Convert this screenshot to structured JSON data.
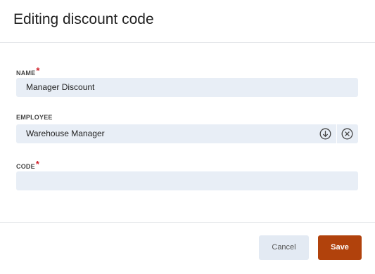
{
  "dialog": {
    "title": "Editing discount code"
  },
  "fields": {
    "name": {
      "label": "NAME",
      "required_mark": "*",
      "value": "Manager Discount",
      "placeholder": ""
    },
    "employee": {
      "label": "EMPLOYEE",
      "value": "Warehouse Manager",
      "icons": [
        "chevron-down-circle-icon",
        "clear-circle-icon"
      ]
    },
    "code": {
      "label": "CODE",
      "required_mark": "*",
      "value": "",
      "placeholder": ""
    }
  },
  "footer": {
    "cancel_label": "Cancel",
    "save_label": "Save"
  },
  "colors": {
    "accent": "#b1420c",
    "input_bg": "#e8eef6",
    "required": "#d0202a"
  }
}
